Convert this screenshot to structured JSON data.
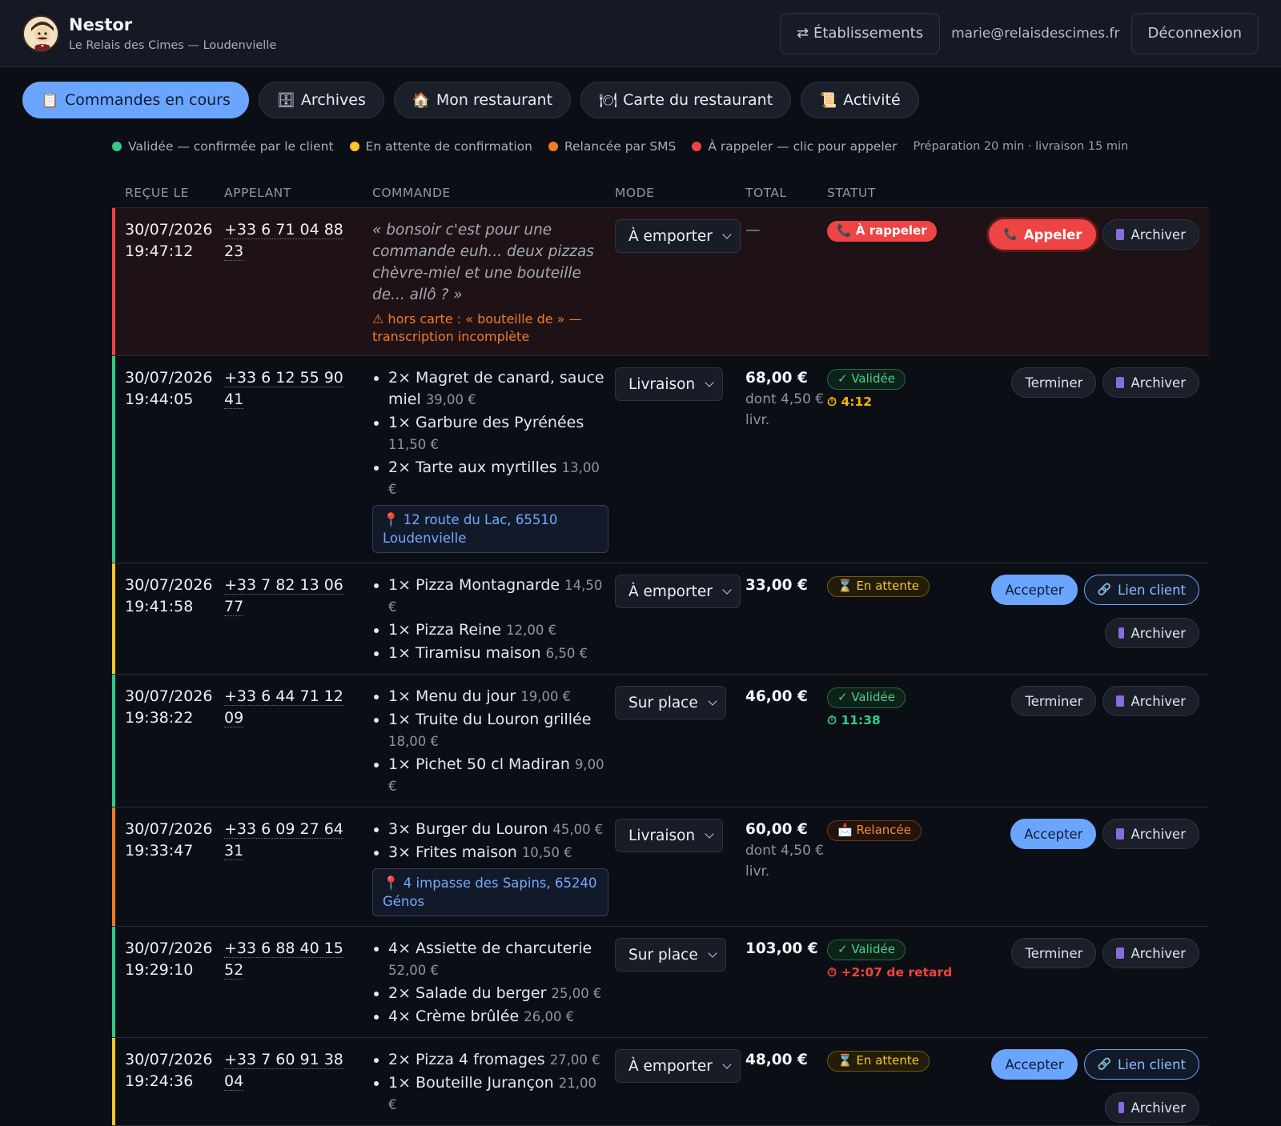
{
  "app": {
    "name": "Nestor",
    "subtitle": "Le Relais des Cimes — Loudenvielle",
    "establishments_label": "⇄ Établissements",
    "user_email": "marie@relaisdescimes.fr",
    "logout_label": "Déconnexion"
  },
  "tabs": [
    {
      "label": "Commandes en cours",
      "icon": "clipboard-icon",
      "glyph": "📋",
      "active": true
    },
    {
      "label": "Archives",
      "icon": "archive-icon",
      "glyph": "🗄",
      "active": false
    },
    {
      "label": "Mon restaurant",
      "icon": "house-icon",
      "glyph": "🏠",
      "active": false
    },
    {
      "label": "Carte du restaurant",
      "icon": "plate-icon",
      "glyph": "🍽",
      "active": false
    },
    {
      "label": "Activité",
      "icon": "scroll-icon",
      "glyph": "📜",
      "active": false
    }
  ],
  "legend": {
    "items": [
      {
        "label": "Validée — confirmée par le client",
        "color": "#34c98a"
      },
      {
        "label": "En attente de confirmation",
        "color": "#f4c531"
      },
      {
        "label": "Relancée par SMS",
        "color": "#f07a2a"
      },
      {
        "label": "À rappeler — clic pour appeler",
        "color": "#ef4444"
      }
    ],
    "prep": "Préparation 20 min · livraison 15 min"
  },
  "columns": [
    "REÇUE LE",
    "APPELANT",
    "COMMANDE",
    "MODE",
    "TOTAL",
    "STATUT"
  ],
  "orders": [
    {
      "date": "30/07/2026",
      "time": "19:47:12",
      "caller": "+33 6 71 04 88 23",
      "bar_color": "#ef4444",
      "alert": true,
      "quote": "« bonsoir c'est pour une commande euh... deux pizzas chèvre-miel et une bouteille de... allô ? »",
      "warning": "⚠ hors carte : « bouteille de » — transcription incomplète",
      "items": [],
      "address": "",
      "mode": "À emporter",
      "total": "—",
      "total_sub": "",
      "status": {
        "label": "📞 À rappeler",
        "kind": "call"
      },
      "timer": "",
      "timer_kind": "",
      "actions": [
        "Appeler",
        "Archiver"
      ]
    },
    {
      "date": "30/07/2026",
      "time": "19:44:05",
      "caller": "+33 6 12 55 90 41",
      "bar_color": "#34c98a",
      "alert": false,
      "quote": "",
      "warning": "",
      "items": [
        {
          "text": "2× Magret de canard, sauce miel",
          "price": "39,00 €"
        },
        {
          "text": "1× Garbure des Pyrénées",
          "price": "11,50 €"
        },
        {
          "text": "2× Tarte aux myrtilles",
          "price": "13,00 €"
        }
      ],
      "address": "📍 12 route du Lac, 65510 Loudenvielle",
      "mode": "Livraison",
      "total": "68,00 €",
      "total_sub": "dont 4,50 € livr.",
      "status": {
        "label": "✓ Validée",
        "kind": "ok"
      },
      "timer": "⏱ 4:12",
      "timer_kind": "ok",
      "actions": [
        "Terminer",
        "Archiver"
      ]
    },
    {
      "date": "30/07/2026",
      "time": "19:41:58",
      "caller": "+33 7 82 13 06 77",
      "bar_color": "#f4c531",
      "alert": false,
      "quote": "",
      "warning": "",
      "items": [
        {
          "text": "1× Pizza Montagnarde",
          "price": "14,50 €"
        },
        {
          "text": "1× Pizza Reine",
          "price": "12,00 €"
        },
        {
          "text": "1× Tiramisu maison",
          "price": "6,50 €"
        }
      ],
      "address": "",
      "mode": "À emporter",
      "total": "33,00 €",
      "total_sub": "",
      "status": {
        "label": "⌛ En attente",
        "kind": "wait"
      },
      "timer": "",
      "timer_kind": "",
      "actions": [
        "Accepter",
        "Lien client",
        "Archiver"
      ]
    },
    {
      "date": "30/07/2026",
      "time": "19:38:22",
      "caller": "+33 6 44 71 12 09",
      "bar_color": "#34c98a",
      "alert": false,
      "quote": "",
      "warning": "",
      "items": [
        {
          "text": "1× Menu du jour",
          "price": "19,00 €"
        },
        {
          "text": "1× Truite du Louron grillée",
          "price": "18,00 €"
        },
        {
          "text": "1× Pichet 50 cl Madiran",
          "price": "9,00 €"
        }
      ],
      "address": "",
      "mode": "Sur place",
      "total": "46,00 €",
      "total_sub": "",
      "status": {
        "label": "✓ Validée",
        "kind": "ok"
      },
      "timer": "⏱ 11:38",
      "timer_kind": "green",
      "actions": [
        "Terminer",
        "Archiver"
      ]
    },
    {
      "date": "30/07/2026",
      "time": "19:33:47",
      "caller": "+33 6 09 27 64 31",
      "bar_color": "#f07a2a",
      "alert": false,
      "quote": "",
      "warning": "",
      "items": [
        {
          "text": "3× Burger du Louron",
          "price": "45,00 €"
        },
        {
          "text": "3× Frites maison",
          "price": "10,50 €"
        }
      ],
      "address": "📍 4 impasse des Sapins, 65240 Génos",
      "mode": "Livraison",
      "total": "60,00 €",
      "total_sub": "dont 4,50 € livr.",
      "status": {
        "label": "📩 Relancée",
        "kind": "sms"
      },
      "timer": "",
      "timer_kind": "",
      "actions": [
        "Accepter",
        "Archiver"
      ]
    },
    {
      "date": "30/07/2026",
      "time": "19:29:10",
      "caller": "+33 6 88 40 15 52",
      "bar_color": "#34c98a",
      "alert": false,
      "quote": "",
      "warning": "",
      "items": [
        {
          "text": "4× Assiette de charcuterie",
          "price": "52,00 €"
        },
        {
          "text": "2× Salade du berger",
          "price": "25,00 €"
        },
        {
          "text": "4× Crème brûlée",
          "price": "26,00 €"
        }
      ],
      "address": "",
      "mode": "Sur place",
      "total": "103,00 €",
      "total_sub": "",
      "status": {
        "label": "✓ Validée",
        "kind": "ok"
      },
      "timer": "⏱ +2:07 de retard",
      "timer_kind": "late",
      "actions": [
        "Terminer",
        "Archiver"
      ]
    },
    {
      "date": "30/07/2026",
      "time": "19:24:36",
      "caller": "+33 7 60 91 38 04",
      "bar_color": "#f4c531",
      "alert": false,
      "quote": "",
      "warning": "",
      "items": [
        {
          "text": "2× Pizza 4 fromages",
          "price": "27,00 €"
        },
        {
          "text": "1× Bouteille Jurançon",
          "price": "21,00 €"
        }
      ],
      "address": "",
      "mode": "À emporter",
      "total": "48,00 €",
      "total_sub": "",
      "status": {
        "label": "⌛ En attente",
        "kind": "wait"
      },
      "timer": "",
      "timer_kind": "",
      "actions": [
        "Accepter",
        "Lien client",
        "Archiver"
      ]
    }
  ]
}
